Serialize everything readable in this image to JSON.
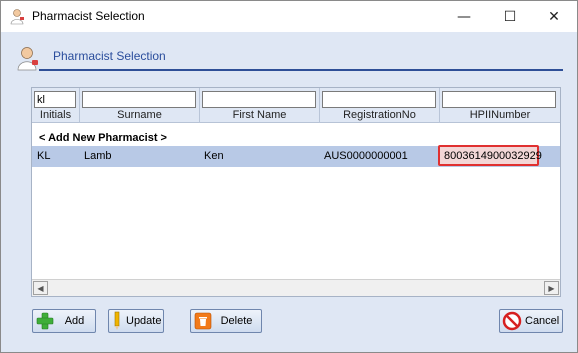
{
  "window": {
    "title": "Pharmacist Selection",
    "minimize_glyph": "—",
    "maximize_glyph": "☐",
    "close_glyph": "✕"
  },
  "header": {
    "title": "Pharmacist Selection",
    "icon": "pharmacist-icon"
  },
  "grid": {
    "filters": {
      "initials": "kl",
      "surname": "",
      "first_name": "",
      "registration_no": "",
      "hpii_number": ""
    },
    "columns": [
      "Initials",
      "Surname",
      "First Name",
      "RegistrationNo",
      "HPIINumber"
    ],
    "add_new_label": "< Add New Pharmacist >",
    "rows": [
      {
        "initials": "KL",
        "surname": "Lamb",
        "first_name": "Ken",
        "registration_no": "AUS0000000001",
        "hpii_number": "8003614900032929"
      }
    ],
    "scroll_left": "◀",
    "scroll_right": "▶"
  },
  "buttons": {
    "add": "Add",
    "update": "Update",
    "delete": "Delete",
    "cancel": "Cancel"
  },
  "colors": {
    "selected_row": "#b8c9e6",
    "highlight_border": "#e03030",
    "header_accent": "#2e4f97"
  }
}
